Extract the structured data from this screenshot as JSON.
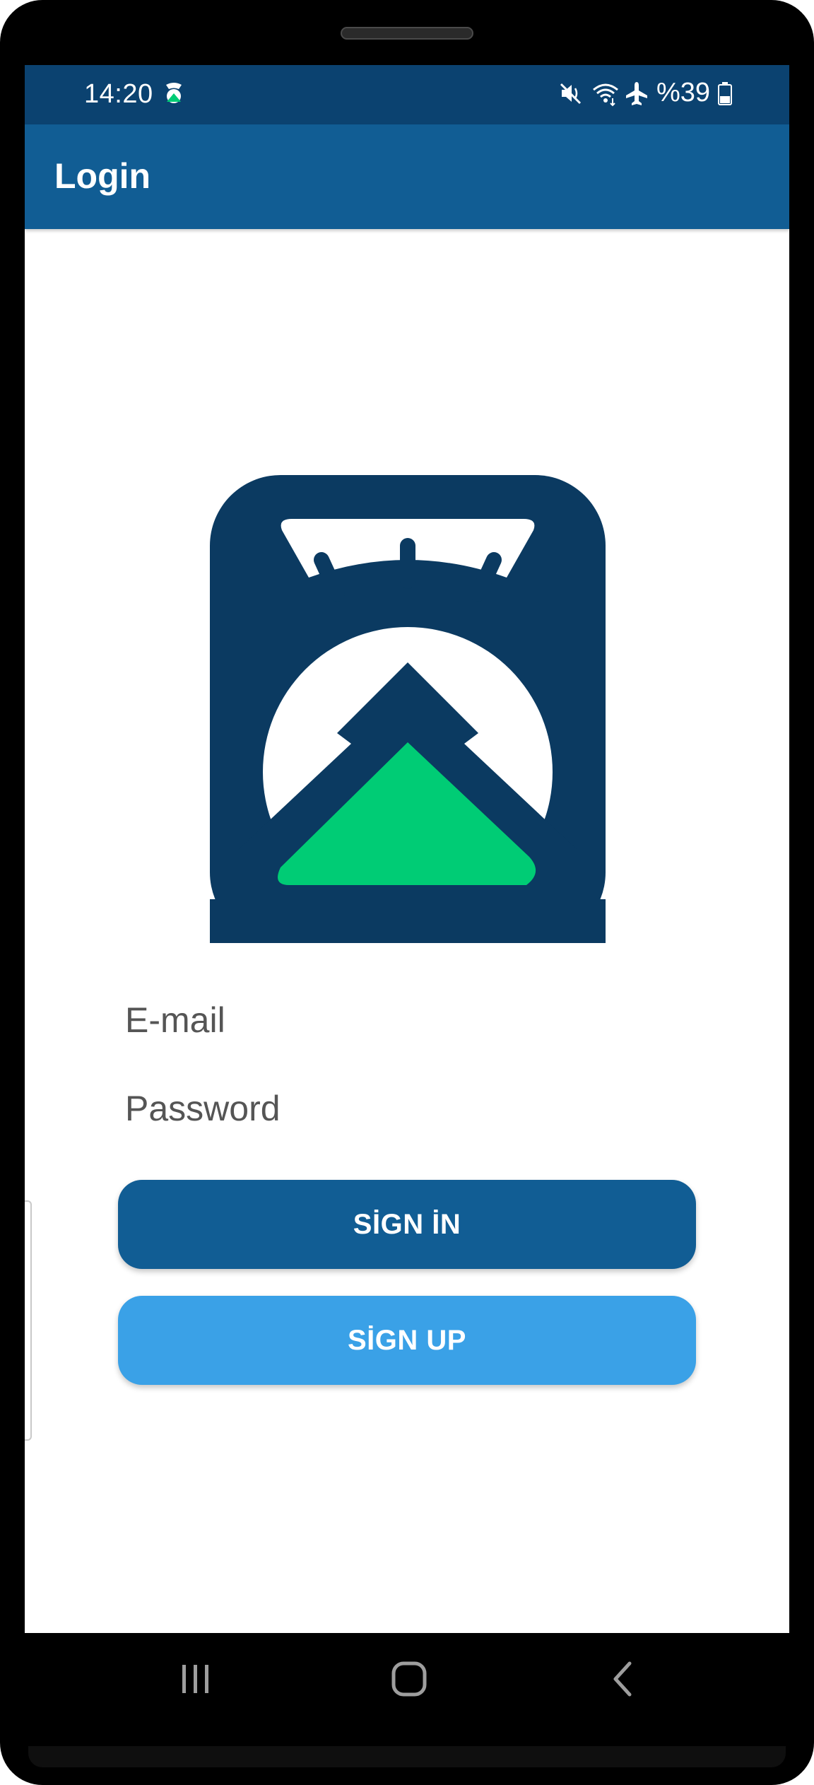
{
  "status_bar": {
    "time": "14:20",
    "app_icon": "scale-app-icon",
    "battery": "%39",
    "icons": [
      "mute-icon",
      "wifi-icon",
      "airplane-mode-icon",
      "battery-icon"
    ],
    "background": "#0b4270"
  },
  "app_bar": {
    "title": "Login",
    "background": "#115d94"
  },
  "logo": {
    "icon": "weighing-scale-arrow-logo",
    "colors": {
      "primary": "#0b3a61",
      "accent": "#00cc75",
      "face": "#ffffff"
    }
  },
  "form": {
    "email_placeholder": "E-mail",
    "email_value": "",
    "password_placeholder": "Password",
    "password_value": ""
  },
  "buttons": {
    "sign_in_label": "SİGN İN",
    "sign_in_color": "#115d94",
    "sign_up_label": "SİGN UP",
    "sign_up_color": "#3aa1e7"
  },
  "nav_bar": {
    "icons": [
      "recents-icon",
      "home-icon",
      "back-icon"
    ]
  }
}
